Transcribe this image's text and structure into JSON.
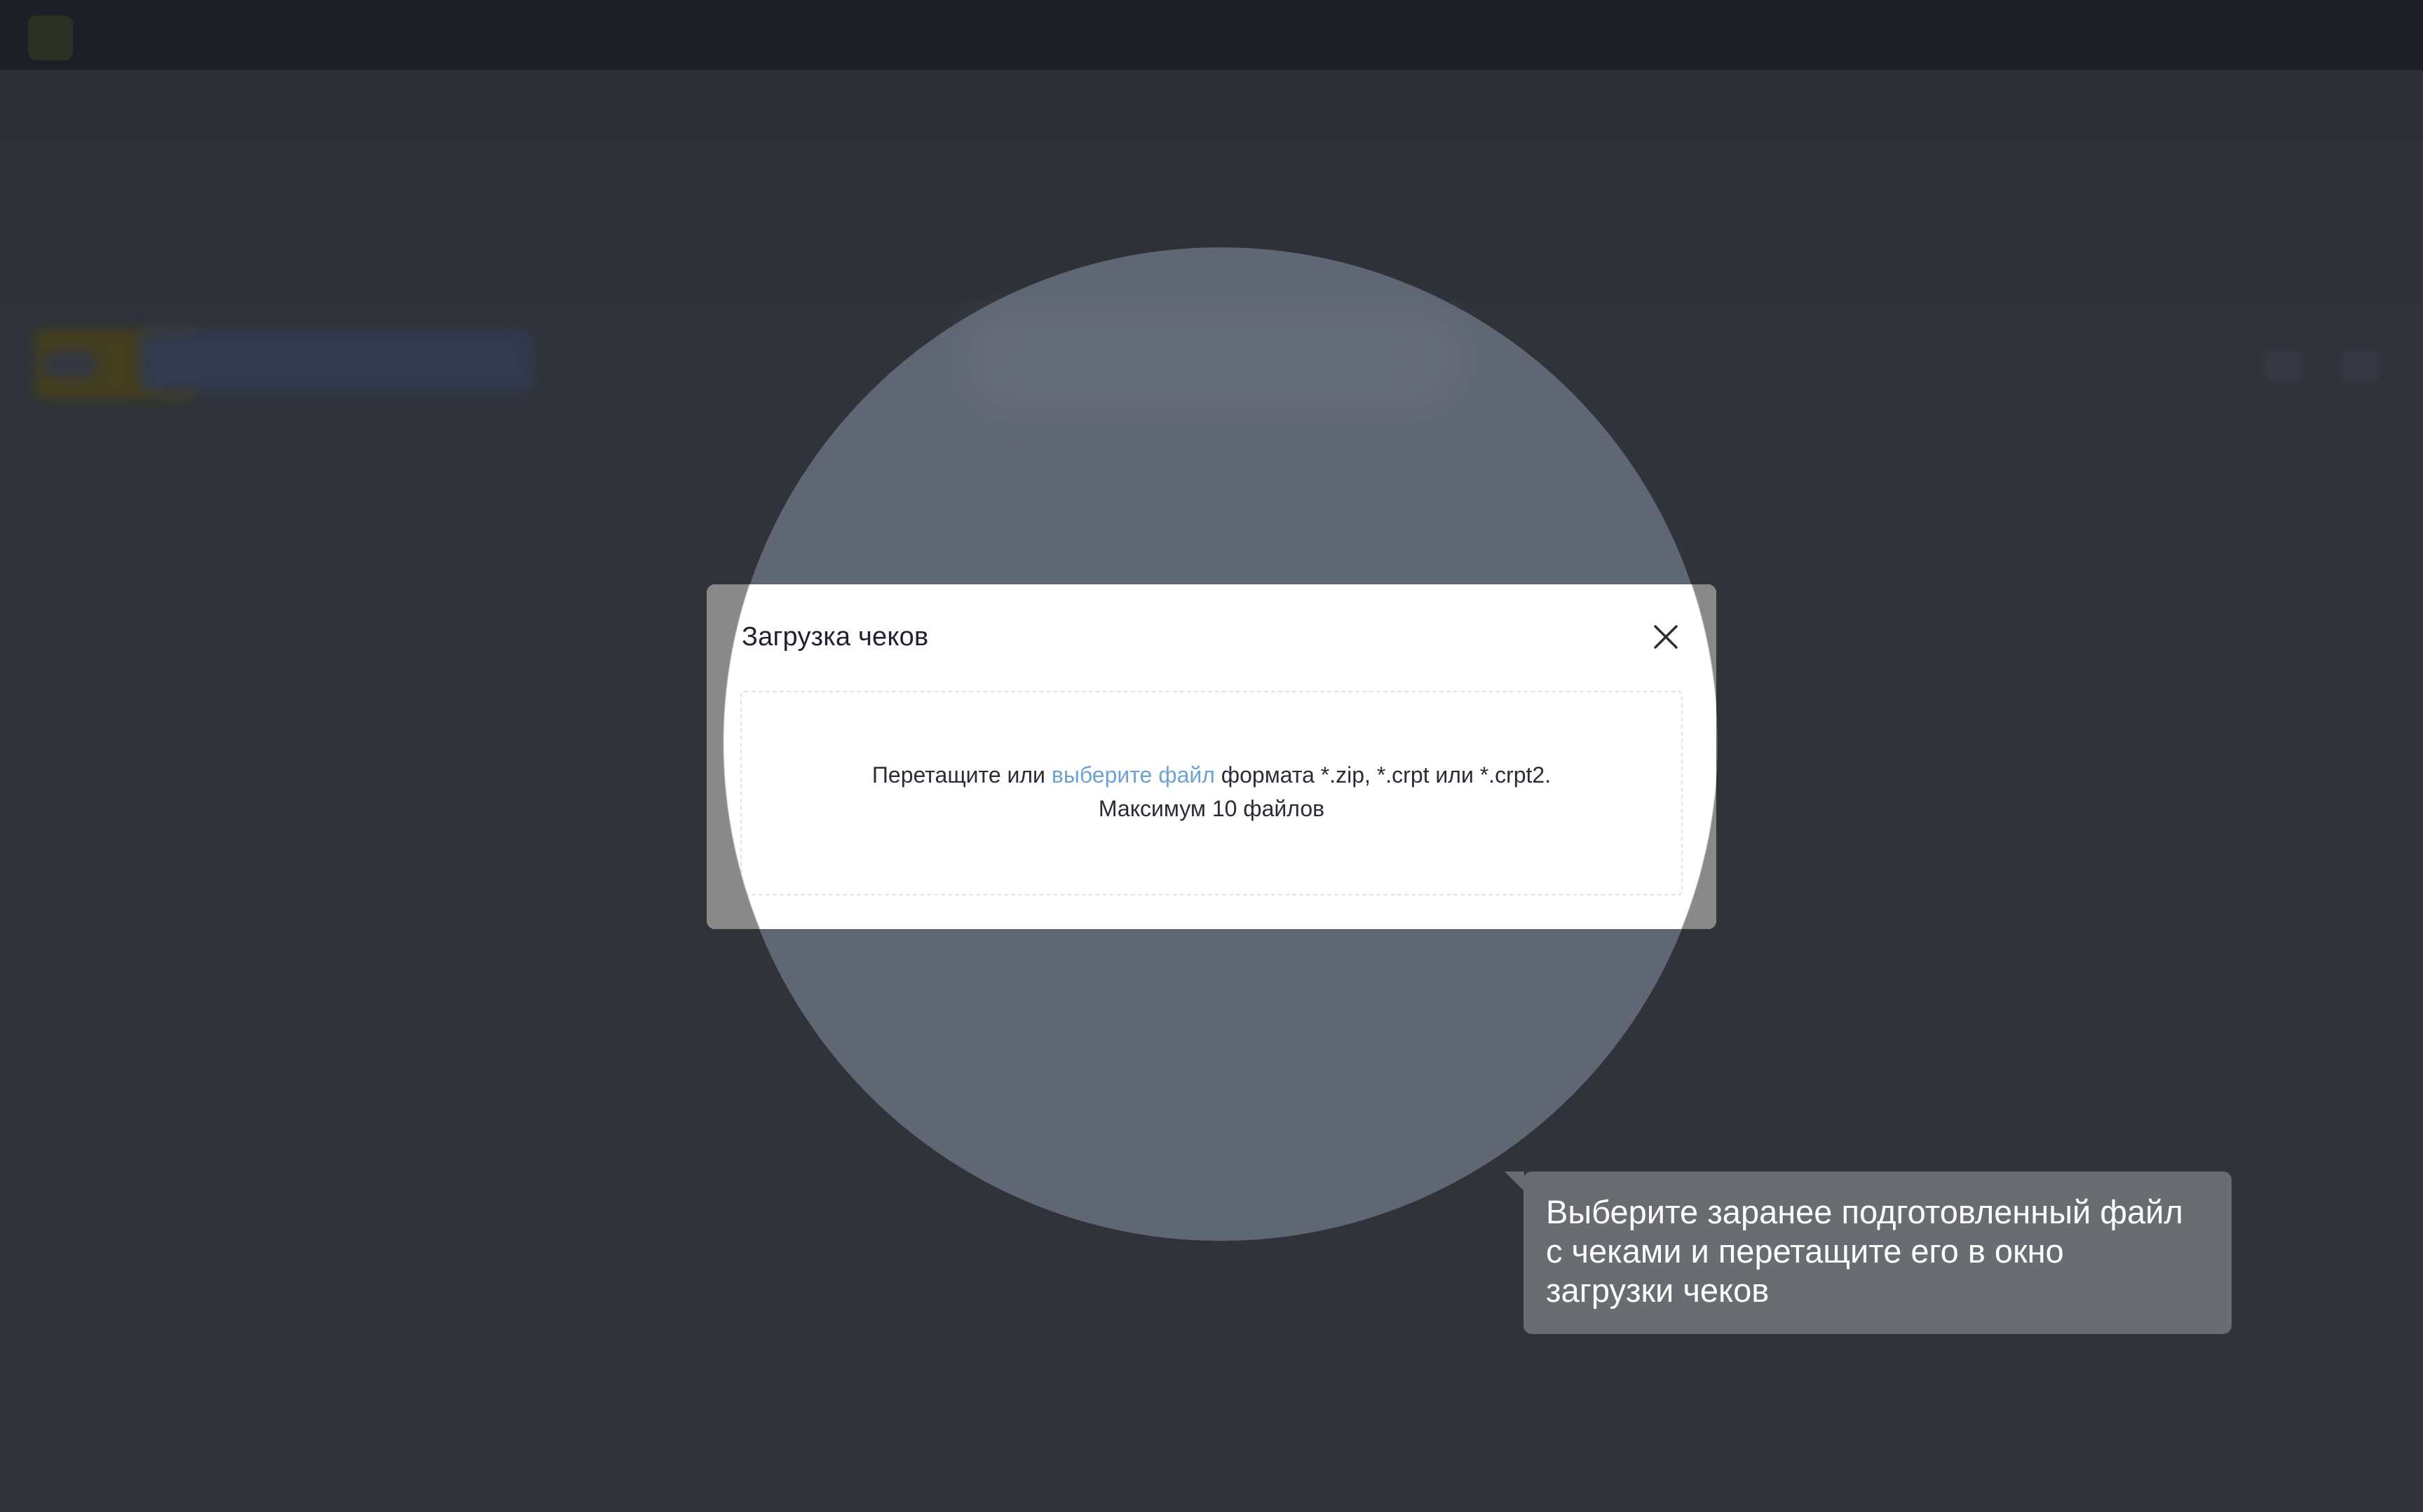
{
  "modal": {
    "title": "Загрузка чеков",
    "close_icon": "close-icon",
    "dropzone": {
      "text_before": "Перетащите или ",
      "link": "выберите файл",
      "text_after": " формата *.zip, *.crpt или *.crpt2.",
      "limit": "Максимум 10 файлов"
    }
  },
  "tooltip": {
    "lines": [
      "Выберите заранее подготовленный файл",
      "с чеками и перетащите его в окно",
      "загрузки чеков"
    ]
  },
  "colors": {
    "backdrop": "#30333a",
    "spotlight": "#606774",
    "link": "#6ea2d4",
    "tooltip": "#696c70"
  }
}
